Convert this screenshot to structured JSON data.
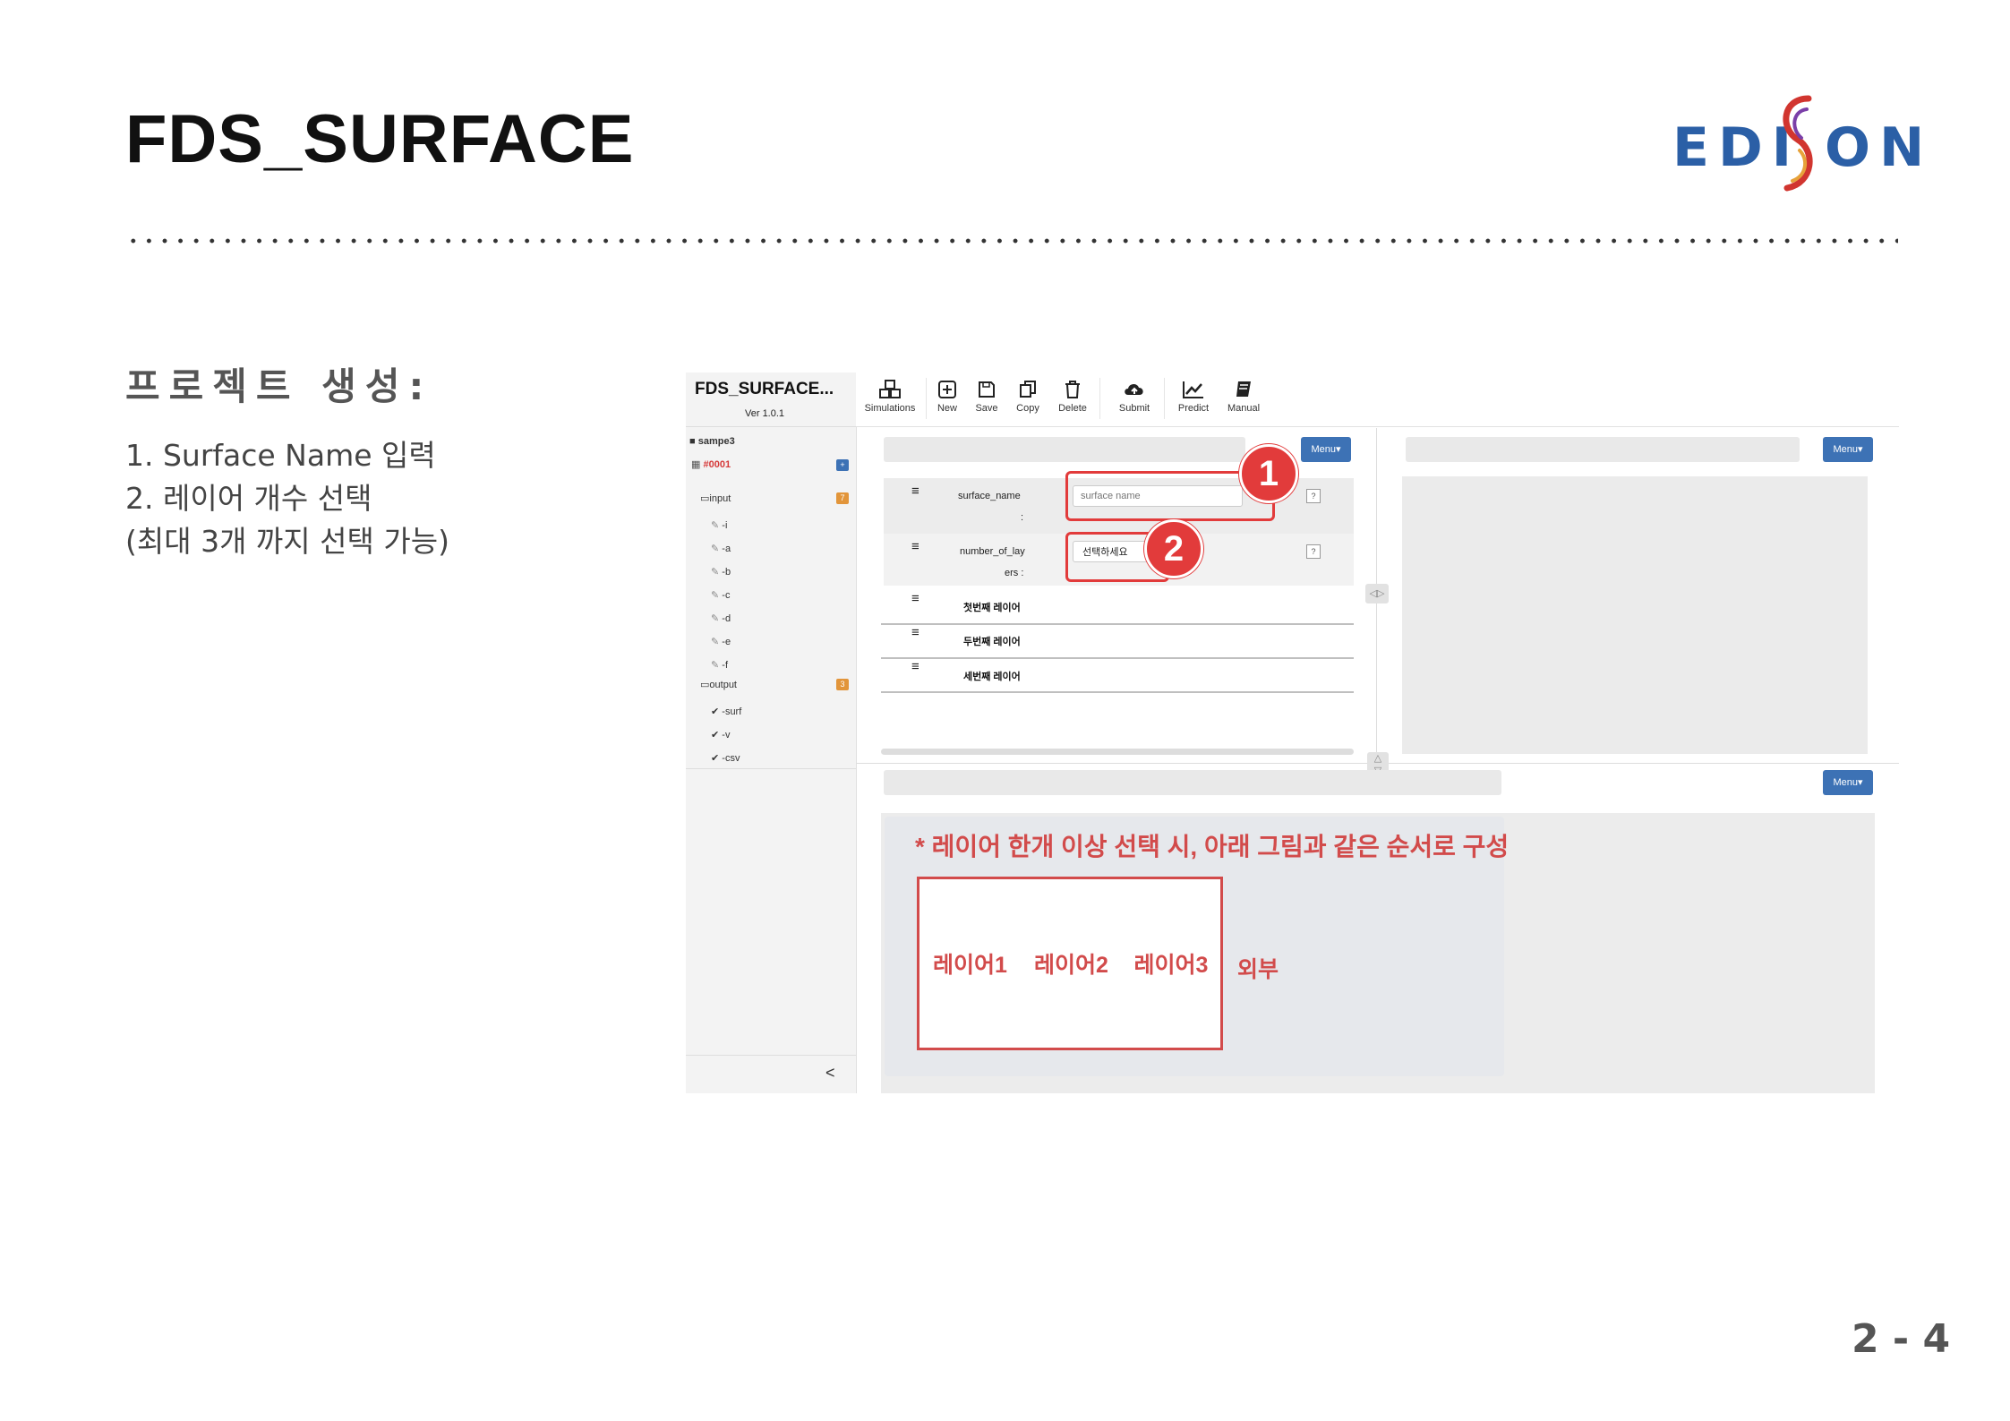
{
  "slide": {
    "title": "FDS_SURFACE",
    "logo_text_left": "EDI",
    "logo_text_right": "ON",
    "logo_s": "S",
    "section_heading": "프로젝트 생성:",
    "steps": [
      "1. Surface Name 입력",
      "2. 레이어 개수 선택",
      "(최대 3개 까지 선택 가능)"
    ],
    "page_number": "2 - 4"
  },
  "app": {
    "sidebar": {
      "title": "FDS_SURFACE...",
      "version": "Ver 1.0.1",
      "project": "sampe3",
      "simulation": "#0001",
      "input_label": "input",
      "input_count": "7",
      "input_items": [
        "-i",
        "-a",
        "-b",
        "-c",
        "-d",
        "-e",
        "-f"
      ],
      "output_label": "output",
      "output_count": "3",
      "output_items": [
        "-surf",
        "-v",
        "-csv"
      ],
      "collapse": "<"
    },
    "toolbar": {
      "simulations": "Simulations",
      "new": "New",
      "save": "Save",
      "copy": "Copy",
      "delete": "Delete",
      "submit": "Submit",
      "predict": "Predict",
      "manual": "Manual"
    },
    "menu_label": "Menu▾",
    "form": {
      "surface_name_label_1": "surface_name",
      "surface_name_label_2": ":",
      "surface_name_placeholder": "surface name",
      "layers_label_1": "number_of_lay",
      "layers_label_2": "ers :",
      "layers_select": "선택하세요",
      "help": "?",
      "layers": [
        "첫번째 레이어",
        "두번째 레이어",
        "세번째 레이어"
      ]
    },
    "callouts": [
      "1",
      "2"
    ],
    "note": "* 레이어 한개 이상 선택 시, 아래 그림과 같은 순서로 구성",
    "diagram": {
      "cells": [
        "레이어1",
        "레이어2",
        "레이어3"
      ],
      "outside": "외부"
    }
  },
  "colors": {
    "accent_blue": "#3d72b5",
    "callout_red": "#e23b3b",
    "note_red": "#d24b4b"
  }
}
